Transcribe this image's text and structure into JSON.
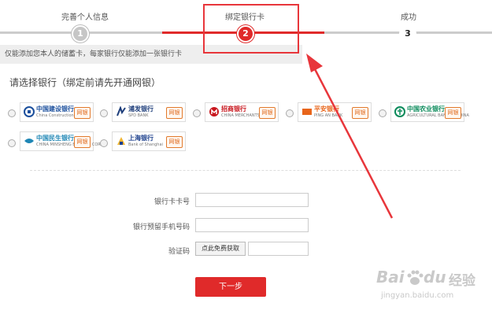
{
  "steps": [
    {
      "label": "完善个人信息",
      "number": "1"
    },
    {
      "label": "绑定银行卡",
      "number": "2"
    },
    {
      "label": "成功",
      "number": "3"
    }
  ],
  "notice": "仅能添加您本人的储蓄卡，每家银行仅能添加一张银行卡",
  "prompt": "请选择银行（绑定前请先开通网银）",
  "banks": [
    {
      "name": "中国建设银行",
      "en": "China Construction Bank",
      "badge": "网银",
      "color": "#1a4e9c"
    },
    {
      "name": "浦发银行",
      "en": "SPD BANK",
      "badge": "网银",
      "color": "#1d3d7a"
    },
    {
      "name": "招商银行",
      "en": "CHINA MERCHANTS BANK",
      "badge": "网银",
      "color": "#c8161d"
    },
    {
      "name": "平安银行",
      "en": "PING AN BANK",
      "badge": "网银",
      "color": "#e8651a"
    },
    {
      "name": "中国农业银行",
      "en": "AGRICULTURAL BANK OF CHINA",
      "badge": "网银",
      "color": "#0a8a5a"
    },
    {
      "name": "中国民生银行",
      "en": "CHINA MINSHENG BANKING CORP",
      "badge": "网银",
      "color": "#1e86b5"
    },
    {
      "name": "上海银行",
      "en": "Bank of Shanghai",
      "badge": "网银",
      "color": "#1c3f8c"
    }
  ],
  "form": {
    "card_number_label": "银行卡卡号",
    "card_number_value": "",
    "phone_label": "银行预留手机号码",
    "phone_value": "",
    "code_label": "验证码",
    "get_code_button": "点此免费获取",
    "code_value": "",
    "next_button": "下一步"
  },
  "watermark": {
    "brand": "Bai",
    "brand2": "du",
    "product": "经验",
    "url": "jingyan.baidu.com"
  },
  "colors": {
    "accent": "#e02a2a",
    "annotation": "#e8363b",
    "track_gray": "#cccccc"
  }
}
